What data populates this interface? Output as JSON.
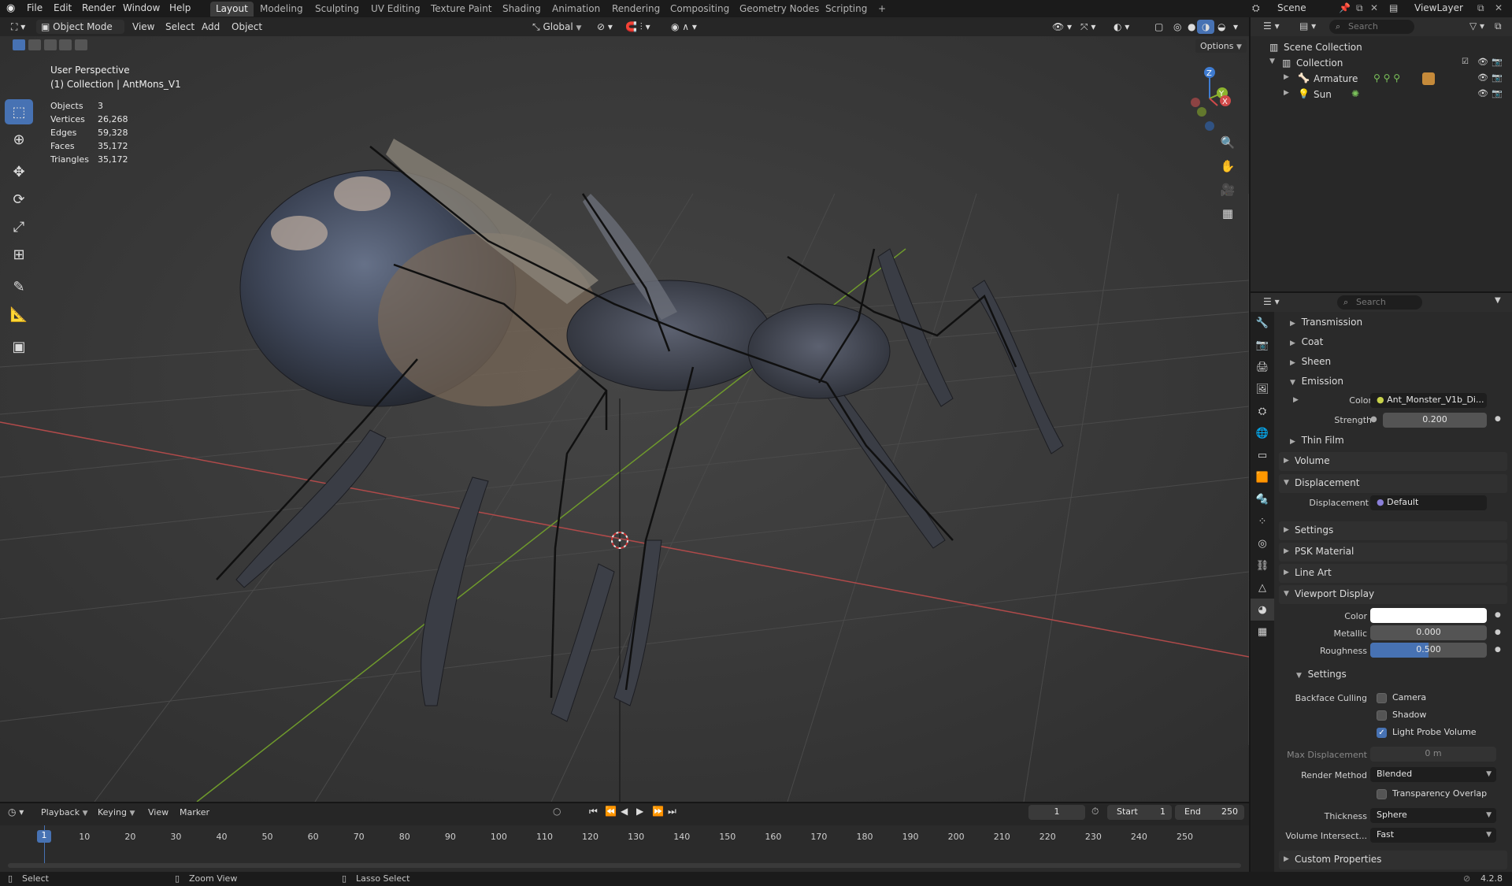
{
  "topbar": {
    "menus": [
      "File",
      "Edit",
      "Render",
      "Window",
      "Help"
    ],
    "workspaces": [
      "Layout",
      "Modeling",
      "Sculpting",
      "UV Editing",
      "Texture Paint",
      "Shading",
      "Animation",
      "Rendering",
      "Compositing",
      "Geometry Nodes",
      "Scripting"
    ],
    "active_workspace": "Layout",
    "add_tab": "+",
    "scene_label": "Scene",
    "viewlayer_label": "ViewLayer"
  },
  "viewport_header": {
    "mode": "Object Mode",
    "menus": [
      "View",
      "Select",
      "Add",
      "Object"
    ],
    "orientation": "Global",
    "options": "Options"
  },
  "viewport": {
    "perspective": "User Perspective",
    "collection": "(1) Collection | AntMons_V1",
    "stats": [
      {
        "label": "Objects",
        "value": "3"
      },
      {
        "label": "Vertices",
        "value": "26,268"
      },
      {
        "label": "Edges",
        "value": "59,328"
      },
      {
        "label": "Faces",
        "value": "35,172"
      },
      {
        "label": "Triangles",
        "value": "35,172"
      }
    ],
    "gizmo": {
      "z": "Z",
      "y": "Y",
      "x": "X"
    },
    "tools": [
      "select-box-icon",
      "cursor-icon",
      "move-icon",
      "rotate-icon",
      "scale-icon",
      "transform-icon",
      "annotate-icon",
      "measure-icon",
      "add-cube-icon"
    ]
  },
  "outliner": {
    "search_placeholder": "Search",
    "items": [
      {
        "label": "Scene Collection"
      },
      {
        "label": "Collection"
      },
      {
        "label": "Armature"
      },
      {
        "label": "Sun"
      }
    ]
  },
  "properties": {
    "search_placeholder": "Search",
    "sections": {
      "transmission": "Transmission",
      "coat": "Coat",
      "sheen": "Sheen",
      "emission": "Emission",
      "thin_film": "Thin Film",
      "volume": "Volume",
      "displacement": "Displacement",
      "settings": "Settings",
      "psk_material": "PSK Material",
      "line_art": "Line Art",
      "viewport_display": "Viewport Display",
      "vd_settings": "Settings",
      "custom_properties": "Custom Properties"
    },
    "emission_color_label": "Color",
    "emission_color_value": "Ant_Monster_V1b_Di...",
    "strength_label": "Strength",
    "strength_value": "0.200",
    "displacement_label": "Displacement",
    "displacement_value": "Default",
    "vd_color_label": "Color",
    "vd_color": "#ffffff",
    "metallic_label": "Metallic",
    "metallic_value": "0.000",
    "roughness_label": "Roughness",
    "roughness_value": "0.500",
    "roughness_fraction": 0.5,
    "backface_label": "Backface Culling",
    "camera_label": "Camera",
    "shadow_label": "Shadow",
    "light_probe_label": "Light Probe Volume",
    "max_disp_label": "Max Displacement",
    "max_disp_value": "0 m",
    "render_method_label": "Render Method",
    "render_method_value": "Blended",
    "transparency_overlap_label": "Transparency Overlap",
    "thickness_label": "Thickness",
    "thickness_value": "Sphere",
    "volume_intersect_label": "Volume Intersect...",
    "volume_intersect_value": "Fast"
  },
  "timeline": {
    "menus": [
      "Playback",
      "Keying",
      "View",
      "Marker"
    ],
    "current_frame": "1",
    "start_label": "Start",
    "start_value": "1",
    "end_label": "End",
    "end_value": "250",
    "ticks": [
      "1",
      "10",
      "20",
      "30",
      "40",
      "50",
      "60",
      "70",
      "80",
      "90",
      "100",
      "110",
      "120",
      "130",
      "140",
      "150",
      "160",
      "170",
      "180",
      "190",
      "200",
      "210",
      "220",
      "230",
      "240",
      "250"
    ]
  },
  "statusbar": {
    "select": "Select",
    "zoom": "Zoom View",
    "lasso": "Lasso Select",
    "version": "4.2.8"
  },
  "colors": {
    "accent": "#4772b3",
    "x_axis": "#c24b4b",
    "y_axis": "#6f9a2c"
  }
}
